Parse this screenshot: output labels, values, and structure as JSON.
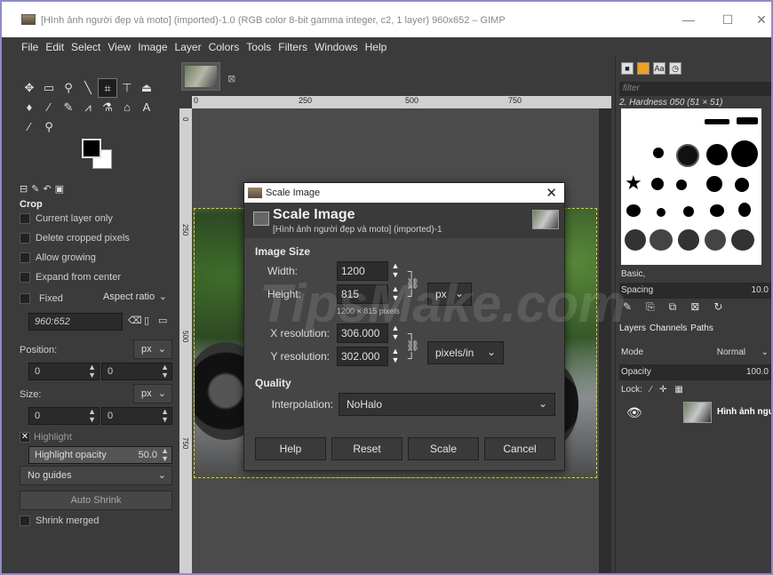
{
  "window": {
    "title": "[Hình ảnh người đẹp và moto] (imported)-1.0 (RGB color 8-bit gamma integer, c2, 1 layer) 960x652 – GIMP",
    "minimize": "—",
    "maximize": "☐",
    "close": "✕"
  },
  "menu": [
    "File",
    "Edit",
    "Select",
    "View",
    "Image",
    "Layer",
    "Colors",
    "Tools",
    "Filters",
    "Windows",
    "Help"
  ],
  "toolbox": {
    "tools_row1": [
      "✥",
      "▭",
      "⚲",
      "╲",
      "⌗",
      "⊤",
      "⏏"
    ],
    "tools_row2": [
      "♦",
      "∕",
      "✎",
      "⩘",
      "⚗",
      "⌂",
      "A"
    ],
    "tools_row3": [
      "∕",
      "⚲"
    ]
  },
  "tool_options": {
    "title": "Crop",
    "current_layer_only": "Current layer only",
    "delete_cropped": "Delete cropped pixels",
    "allow_growing": "Allow growing",
    "expand_center": "Expand from center",
    "fixed_label": "Fixed",
    "aspect_ratio": "Aspect ratio",
    "ratio_value": "960:652",
    "position_label": "Position:",
    "position_unit": "px",
    "pos_x": "0",
    "pos_y": "0",
    "size_label": "Size:",
    "size_unit": "px",
    "size_w": "0",
    "size_h": "0",
    "highlight": "Highlight",
    "highlight_opacity": "Highlight opacity",
    "highlight_opacity_value": "50.0",
    "guides": "No guides",
    "auto_shrink": "Auto Shrink",
    "shrink_merged": "Shrink merged"
  },
  "rulers": {
    "h_ticks": [
      "0",
      "250",
      "500",
      "750"
    ],
    "v_ticks": [
      "0",
      "250",
      "500",
      "750"
    ]
  },
  "dialog": {
    "window_title": "Scale Image",
    "heading": "Scale Image",
    "subheading": "[Hình ảnh người đẹp và moto] (imported)-1",
    "image_size": "Image Size",
    "width_label": "Width:",
    "width_value": "1200",
    "height_label": "Height:",
    "height_value": "815",
    "unit": "px",
    "pixel_info": "1200 × 815 pixels",
    "xres_label": "X resolution:",
    "xres_value": "306.000",
    "yres_label": "Y resolution:",
    "yres_value": "302.000",
    "res_unit": "pixels/in",
    "quality": "Quality",
    "interp_label": "Interpolation:",
    "interp_value": "NoHalo",
    "buttons": {
      "help": "Help",
      "reset": "Reset",
      "scale": "Scale",
      "cancel": "Cancel"
    }
  },
  "brushes": {
    "filter_placeholder": "filter",
    "current": "2. Hardness 050 (51 × 51)",
    "preset": "Basic,",
    "spacing_label": "Spacing",
    "spacing_value": "10.0"
  },
  "layers": {
    "tabs": [
      "Layers",
      "Channels",
      "Paths"
    ],
    "mode_label": "Mode",
    "mode_value": "Normal",
    "opacity_label": "Opacity",
    "opacity_value": "100.0",
    "lock_label": "Lock:",
    "layer_name": "Hình ảnh ngư"
  },
  "watermark": "TipsMake.com"
}
